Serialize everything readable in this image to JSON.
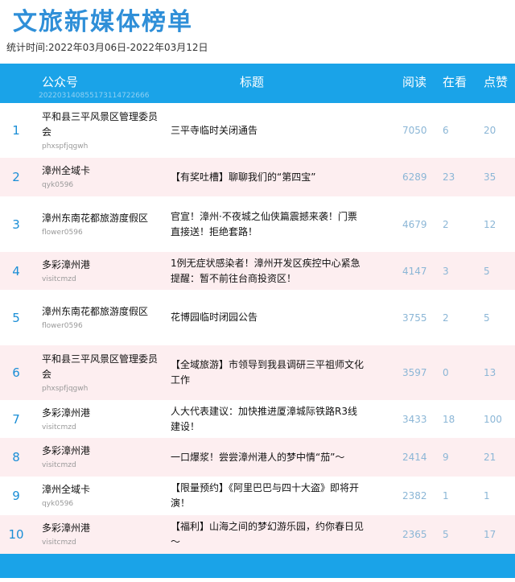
{
  "title": "文旅新媒体榜单",
  "subtitle": "统计时间:2022年03月06日-2022年03月12日",
  "header": {
    "account": "公众号",
    "title": "标题",
    "read": "阅读",
    "watch": "在看",
    "like": "点赞",
    "updated": "20220314085517311472​2666"
  },
  "rows": [
    {
      "rank": "1",
      "account": "平和县三平风景区管理委员会",
      "account_id": "phxspfjqgwh",
      "title": "三平寺临时关闭通告",
      "read": "7050",
      "watch": "6",
      "like": "20"
    },
    {
      "rank": "2",
      "account": "漳州全域卡",
      "account_id": "qyk0596",
      "title": "【有奖吐槽】聊聊我们的“第四宝”",
      "read": "6289",
      "watch": "23",
      "like": "35"
    },
    {
      "rank": "3",
      "account": "漳州东南花都旅游度假区",
      "account_id": "flower0596",
      "title": "官宣！漳州·不夜城之仙侠篇震撼来袭！门票直接送！拒绝套路！",
      "read": "4679",
      "watch": "2",
      "like": "12"
    },
    {
      "rank": "4",
      "account": "多彩漳州港",
      "account_id": "visitcmzd",
      "title": "1例无症状感染者！漳州开发区疾控中心紧急提醒：暂不前往台商投资区！",
      "read": "4147",
      "watch": "3",
      "like": "5"
    },
    {
      "rank": "5",
      "account": "漳州东南花都旅游度假区",
      "account_id": "flower0596",
      "title": "花博园临时闭园公告",
      "read": "3755",
      "watch": "2",
      "like": "5"
    },
    {
      "rank": "6",
      "account": "平和县三平风景区管理委员会",
      "account_id": "phxspfjqgwh",
      "title": "【全域旅游】市领导到我县调研三平祖师文化工作",
      "read": "3597",
      "watch": "0",
      "like": "13"
    },
    {
      "rank": "7",
      "account": "多彩漳州港",
      "account_id": "visitcmzd",
      "title": "人大代表建议：加快推进厦漳城际铁路R3线建设！",
      "read": "3433",
      "watch": "18",
      "like": "100"
    },
    {
      "rank": "8",
      "account": "多彩漳州港",
      "account_id": "visitcmzd",
      "title": "一口爆浆！尝尝漳州港人的梦中情“茄”～",
      "read": "2414",
      "watch": "9",
      "like": "21"
    },
    {
      "rank": "9",
      "account": "漳州全域卡",
      "account_id": "qyk0596",
      "title": "【限量预约】《阿里巴巴与四十大盗》即将开演！",
      "read": "2382",
      "watch": "1",
      "like": "1"
    },
    {
      "rank": "10",
      "account": "多彩漳州港",
      "account_id": "visitcmzd",
      "title": "【福利】山海之间的梦幻游乐园，约你春日见～",
      "read": "2365",
      "watch": "5",
      "like": "17"
    }
  ],
  "colors": {
    "header_bg": "#1aa3e8",
    "title_color": "#2f8fd8",
    "alt_row_bg": "#fdeef0",
    "number_color": "#8bb6d6"
  }
}
